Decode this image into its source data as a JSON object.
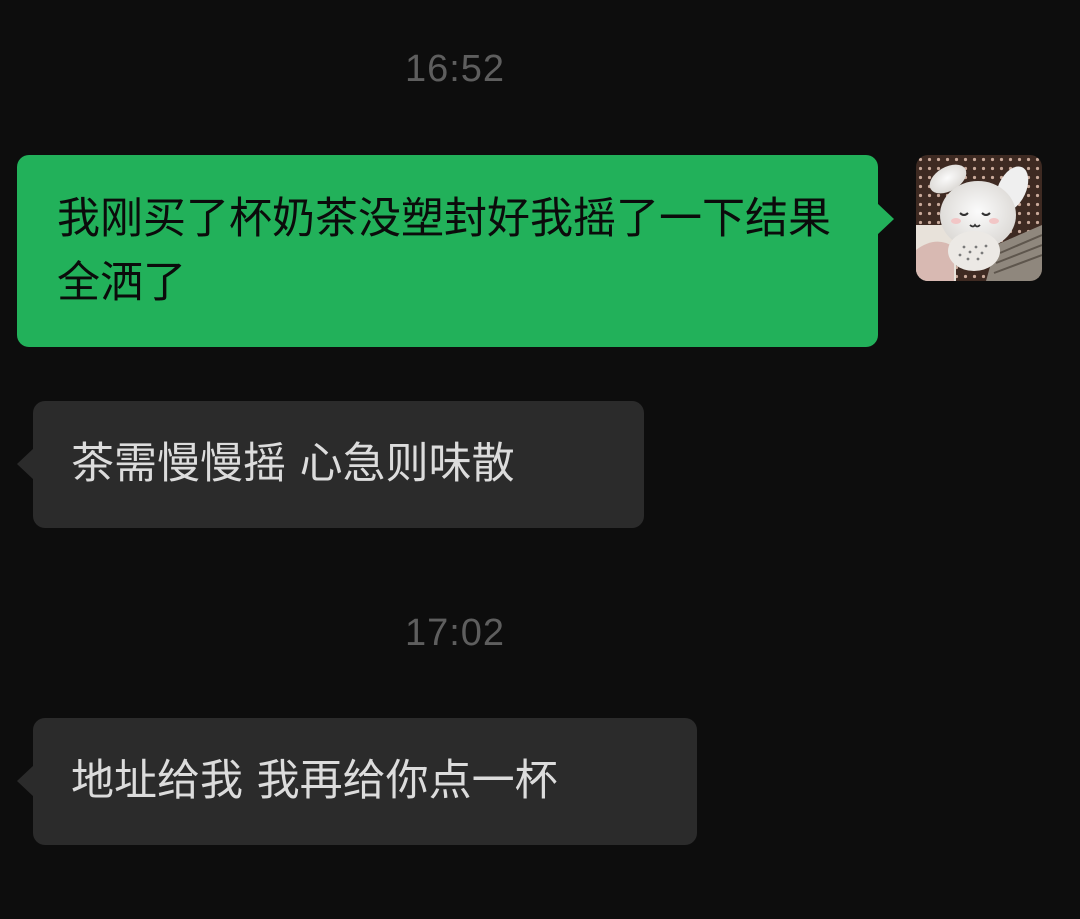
{
  "timestamps": {
    "first": "16:52",
    "second": "17:02"
  },
  "messages": [
    {
      "side": "outgoing",
      "text": "我刚买了杯奶茶没塑封好我摇了一下结果全洒了"
    },
    {
      "side": "incoming",
      "text": "茶需慢慢摇 心急则味散"
    },
    {
      "side": "incoming",
      "text": "地址给我 我再给你点一杯"
    }
  ],
  "avatar": {
    "icon": "bunny-plush-avatar"
  },
  "colors": {
    "background": "#0d0d0d",
    "outgoing_bubble": "#22b15a",
    "incoming_bubble": "#2b2b2b",
    "timestamp": "#5e5e5e",
    "incoming_text": "#dcdcdc"
  }
}
